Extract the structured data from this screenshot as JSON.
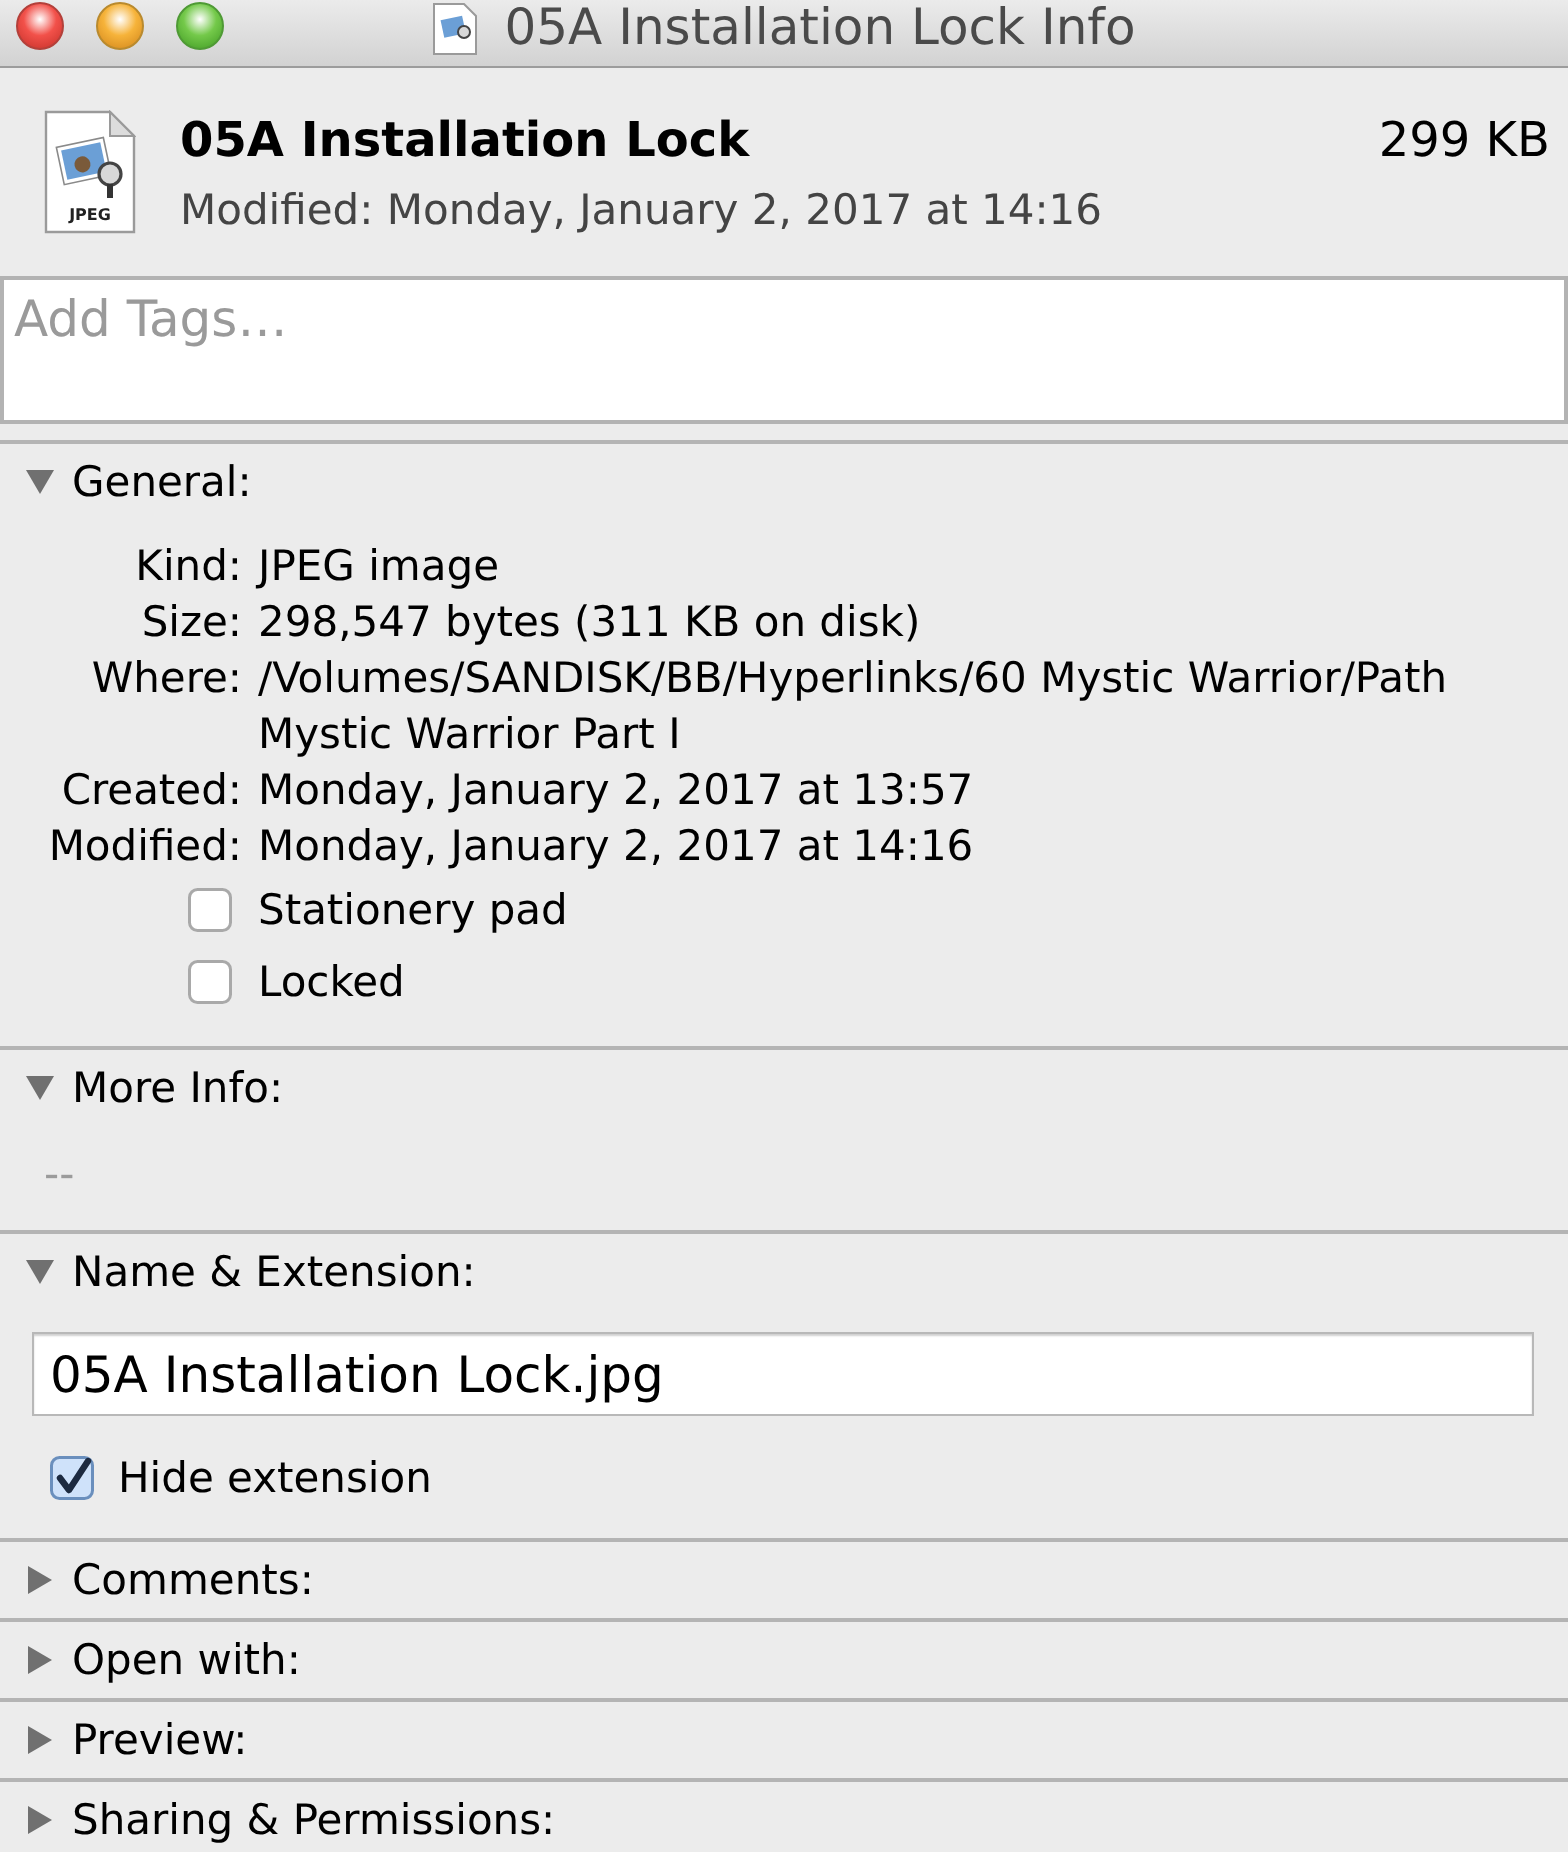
{
  "window": {
    "title": "05A Installation Lock Info"
  },
  "header": {
    "name": "05A Installation Lock",
    "size": "299 KB",
    "modified": "Modified: Monday, January 2, 2017 at 14:16",
    "icon_label": "JPEG"
  },
  "tags": {
    "placeholder": "Add Tags…"
  },
  "sections": [
    {
      "kind": "general",
      "title": "General:",
      "expanded": true,
      "rows": [
        {
          "label": "Kind:",
          "value": "JPEG image"
        },
        {
          "label": "Size:",
          "value": "298,547 bytes (311 KB on disk)"
        },
        {
          "label": "Where:",
          "value": "/Volumes/SANDISK/BB/Hyperlinks/60 Mystic Warrior/Path Mystic Warrior Part I"
        },
        {
          "label": "Created:",
          "value": "Monday, January 2, 2017 at 13:57"
        },
        {
          "label": "Modified:",
          "value": "Monday, January 2, 2017 at 14:16"
        }
      ],
      "options": [
        {
          "label": "Stationery pad",
          "checked": false
        },
        {
          "label": "Locked",
          "checked": false
        }
      ]
    },
    {
      "kind": "more_info",
      "title": "More Info:",
      "expanded": true,
      "value": "--"
    },
    {
      "kind": "name_extension",
      "title": "Name & Extension:",
      "expanded": true,
      "field": {
        "value": "05A Installation Lock.jpg"
      },
      "options": [
        {
          "label": "Hide extension",
          "checked": true
        }
      ]
    },
    {
      "kind": "comments",
      "title": "Comments:",
      "expanded": false
    },
    {
      "kind": "open_with",
      "title": "Open with:",
      "expanded": false
    },
    {
      "kind": "preview",
      "title": "Preview:",
      "expanded": false
    },
    {
      "kind": "sharing",
      "title": "Sharing & Permissions:",
      "expanded": false
    }
  ]
}
